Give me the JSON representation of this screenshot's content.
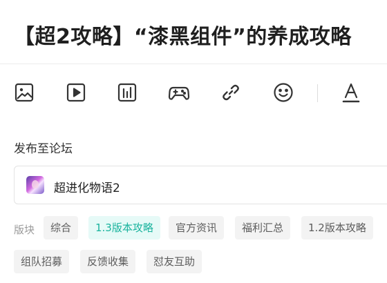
{
  "post": {
    "title": "【超2攻略】“漆黑组件”的养成攻略"
  },
  "toolbar": {
    "items": [
      {
        "icon": "image-icon",
        "action": "insert-image"
      },
      {
        "icon": "video-icon",
        "action": "insert-video"
      },
      {
        "icon": "poll-icon",
        "action": "insert-poll"
      },
      {
        "icon": "game-controller-icon",
        "action": "insert-game"
      },
      {
        "icon": "link-icon",
        "action": "insert-link"
      },
      {
        "icon": "emoji-icon",
        "action": "insert-emoji"
      },
      {
        "icon": "text-format-icon",
        "action": "text-format"
      }
    ]
  },
  "publish": {
    "label": "发布至论坛",
    "forum_name": "超进化物语2"
  },
  "boards": {
    "label": "版块",
    "selected": "1.3版本攻略",
    "tags": [
      "综合",
      "1.3版本攻略",
      "官方资讯",
      "福利汇总",
      "1.2版本攻略",
      "组队招募",
      "反馈收集",
      "怼友互助"
    ]
  },
  "colors": {
    "accent": "#19b39d",
    "accent_bg": "#e6faf7",
    "tag_bg": "#f3f3f3"
  }
}
